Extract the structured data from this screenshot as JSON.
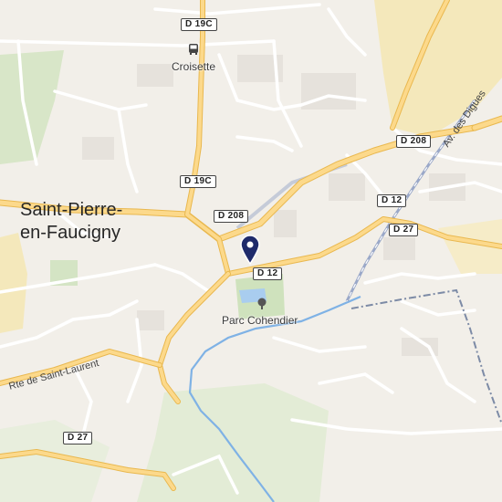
{
  "map": {
    "colors": {
      "land": "#f2efe9",
      "green": "#d8e6c8",
      "industrial": "#f3e6b4",
      "road": "#ffffff",
      "main_road": "#fcd98b",
      "main_road_casing": "#e9b84f",
      "water": "#7fb2e5",
      "rail": "#9aa8c8",
      "border": "#7d8ba6",
      "marker": "#1f2b6b"
    },
    "places": {
      "town_line1": "Saint-Pierre-",
      "town_line2": "en-Faucigny",
      "bus_stop": "Croisette",
      "park": "Parc Cohendier"
    },
    "roads": {
      "d19c_top": "D 19C",
      "d19c_mid": "D 19C",
      "d208_right": "D 208",
      "d208_center": "D 208",
      "d12_right": "D 12",
      "d12_center": "D 12",
      "d27_right": "D 27",
      "d27_bottom": "D 27",
      "rte_saint_laurent": "Rte de Saint-Laurent",
      "av_des_digues": "Av. des Digues"
    },
    "icons": {
      "bus_stop": "bus-icon",
      "park": "tree-icon",
      "marker": "location-pin-icon"
    }
  }
}
